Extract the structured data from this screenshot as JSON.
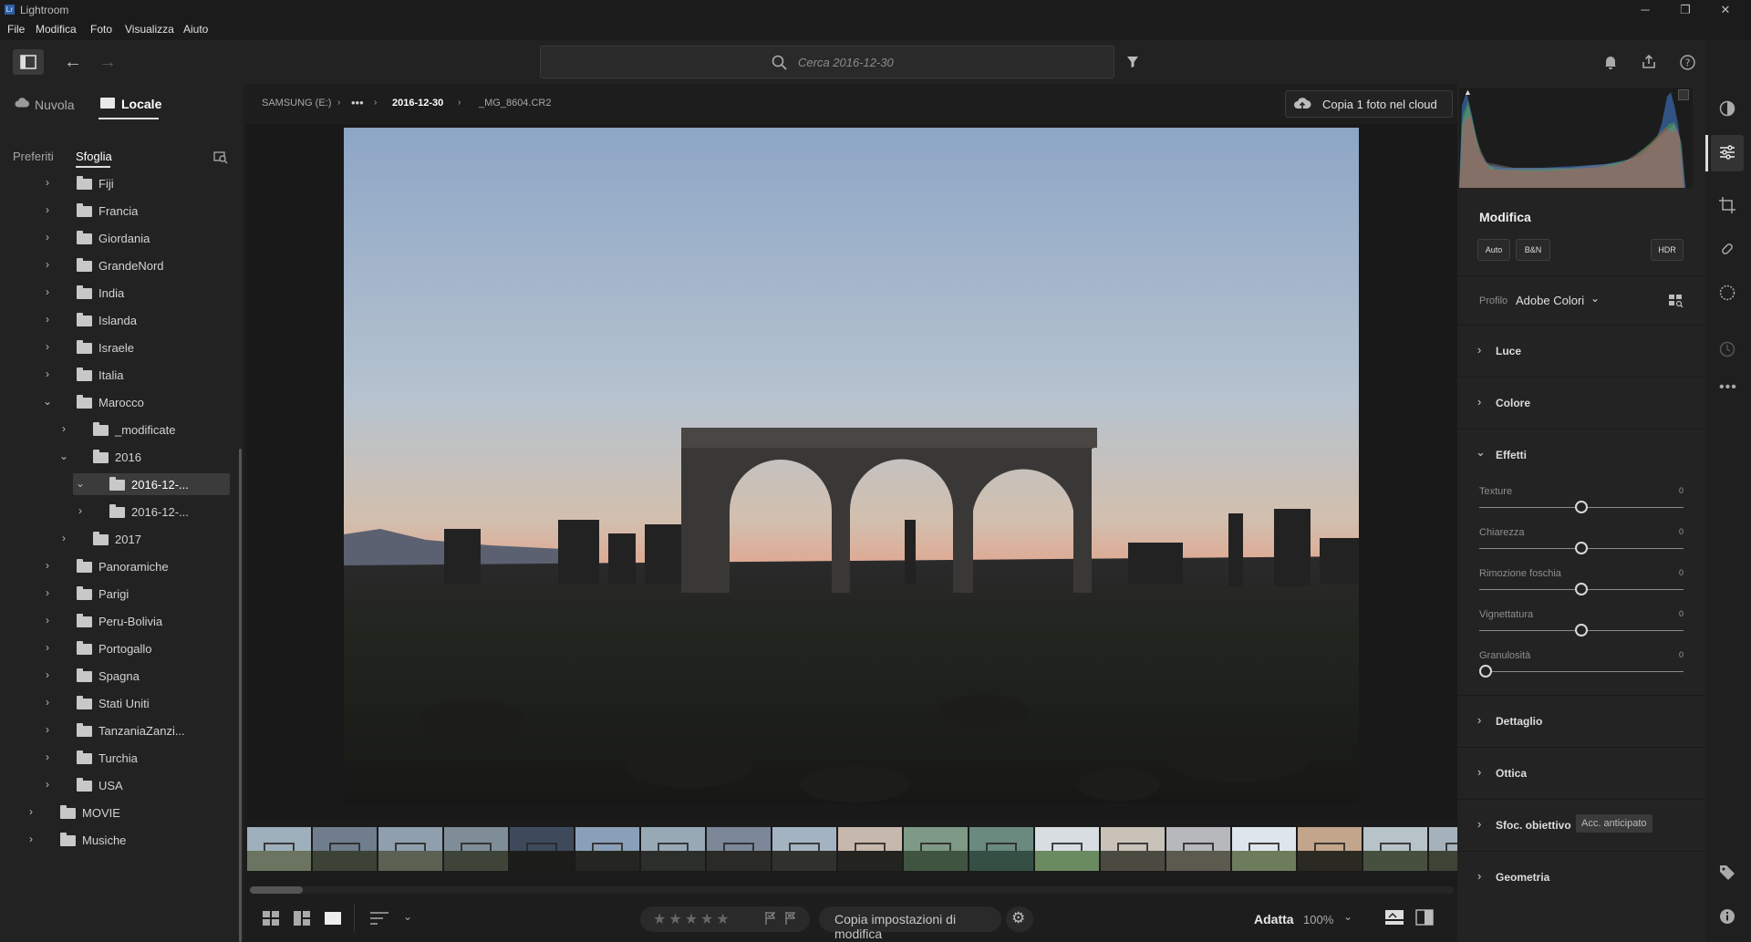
{
  "app": {
    "title": "Lightroom",
    "logo": "Lr"
  },
  "menu": [
    "File",
    "Modifica",
    "Foto",
    "Visualizza",
    "Aiuto"
  ],
  "search": {
    "placeholder": "Cerca 2016-12-30"
  },
  "left": {
    "tabs": {
      "cloud": "Nuvola",
      "local": "Locale"
    },
    "subtabs": {
      "fav": "Preferiti",
      "browse": "Sfoglia"
    },
    "folders": [
      {
        "label": "Fiji",
        "level": 1,
        "expanded": false
      },
      {
        "label": "Francia",
        "level": 1,
        "expanded": false
      },
      {
        "label": "Giordania",
        "level": 1,
        "expanded": false
      },
      {
        "label": "GrandeNord",
        "level": 1,
        "expanded": false
      },
      {
        "label": "India",
        "level": 1,
        "expanded": false
      },
      {
        "label": "Islanda",
        "level": 1,
        "expanded": false
      },
      {
        "label": "Israele",
        "level": 1,
        "expanded": false
      },
      {
        "label": "Italia",
        "level": 1,
        "expanded": false
      },
      {
        "label": "Marocco",
        "level": 1,
        "expanded": true
      },
      {
        "label": "_modificate",
        "level": 2,
        "expanded": false
      },
      {
        "label": "2016",
        "level": 2,
        "expanded": true
      },
      {
        "label": "2016-12-...",
        "level": 3,
        "expanded": true,
        "selected": true
      },
      {
        "label": "2016-12-...",
        "level": 3,
        "expanded": false
      },
      {
        "label": "2017",
        "level": 2,
        "expanded": false
      },
      {
        "label": "Panoramiche",
        "level": 1,
        "expanded": false
      },
      {
        "label": "Parigi",
        "level": 1,
        "expanded": false
      },
      {
        "label": "Peru-Bolivia",
        "level": 1,
        "expanded": false
      },
      {
        "label": "Portogallo",
        "level": 1,
        "expanded": false
      },
      {
        "label": "Spagna",
        "level": 1,
        "expanded": false
      },
      {
        "label": "Stati Uniti",
        "level": 1,
        "expanded": false
      },
      {
        "label": "TanzaniaZanzi...",
        "level": 1,
        "expanded": false
      },
      {
        "label": "Turchia",
        "level": 1,
        "expanded": false
      },
      {
        "label": "USA",
        "level": 1,
        "expanded": false
      },
      {
        "label": "MOVIE",
        "level": 0,
        "expanded": false
      },
      {
        "label": "Musiche",
        "level": 0,
        "expanded": false
      }
    ]
  },
  "breadcrumb": {
    "drive": "SAMSUNG (E:)",
    "more": "•••",
    "folder": "2016-12-30",
    "file": "_MG_8604.CR2"
  },
  "copy_cloud": "Copia 1 foto nel cloud",
  "bottom": {
    "copy_settings": "Copia impostazioni di modifica",
    "fit": "Adatta",
    "zoom": "100%"
  },
  "edit": {
    "title": "Modifica",
    "auto": "Auto",
    "bw": "B&N",
    "hdr": "HDR",
    "profile_label": "Profilo",
    "profile_value": "Adobe Colori",
    "sections": {
      "light": "Luce",
      "color": "Colore",
      "effects": "Effetti",
      "detail": "Dettaglio",
      "optics": "Ottica",
      "lens_blur": "Sfoc. obiettivo",
      "lens_blur_badge": "Acc. anticipato",
      "geometry": "Geometria"
    },
    "effects_sliders": [
      {
        "name": "Texture",
        "value": "0",
        "level": 0.5
      },
      {
        "name": "Chiarezza",
        "value": "0",
        "level": 0.5
      },
      {
        "name": "Rimozione foschia",
        "value": "0",
        "level": 0.5
      },
      {
        "name": "Vignettatura",
        "value": "0",
        "level": 0.5
      },
      {
        "name": "Granulosità",
        "value": "0",
        "level": 0
      }
    ]
  },
  "thumbnail_count": 19,
  "selected_thumbnail": 10
}
